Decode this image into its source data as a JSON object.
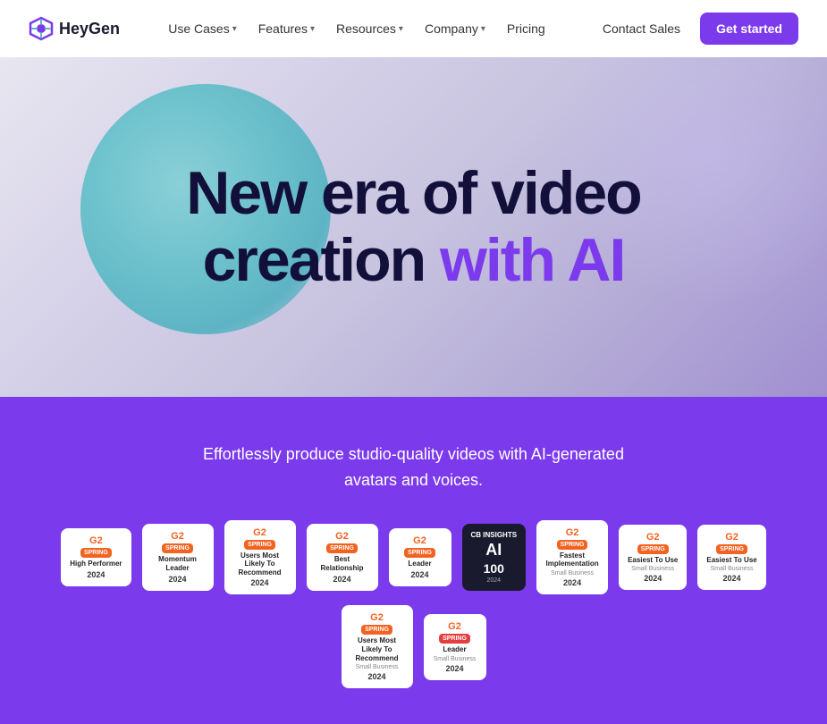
{
  "logo": {
    "text": "HeyGen"
  },
  "nav": {
    "items": [
      {
        "label": "Use Cases",
        "hasDropdown": true
      },
      {
        "label": "Features",
        "hasDropdown": true
      },
      {
        "label": "Resources",
        "hasDropdown": true
      },
      {
        "label": "Company",
        "hasDropdown": true
      },
      {
        "label": "Pricing",
        "hasDropdown": false
      }
    ],
    "contact_sales": "Contact Sales",
    "get_started": "Get started"
  },
  "hero": {
    "line1": "New era of video",
    "line2_plain": "creation ",
    "line2_colored": "with AI"
  },
  "social_proof": {
    "description": "Effortlessly produce studio-quality videos with AI-generated avatars and voices.",
    "badges": [
      {
        "type": "g2",
        "icon": "G2",
        "title": "High Performer",
        "category": "",
        "tag": "SPRING",
        "year": "2024"
      },
      {
        "type": "g2",
        "icon": "G2",
        "title": "Momentum Leader",
        "category": "",
        "tag": "SPRING",
        "year": "2024"
      },
      {
        "type": "g2",
        "icon": "G2",
        "title": "Users Most Likely To Recommend",
        "category": "",
        "tag": "SPRING",
        "year": "2024"
      },
      {
        "type": "g2",
        "icon": "G2",
        "title": "Best Relationship",
        "category": "",
        "tag": "SPRING",
        "year": "2024"
      },
      {
        "type": "g2",
        "icon": "G2",
        "title": "Leader",
        "category": "",
        "tag": "SPRING",
        "year": "2024",
        "highlight": "orange"
      },
      {
        "type": "cb",
        "title": "AI 100",
        "subtitle": "2024"
      },
      {
        "type": "g2",
        "icon": "G2",
        "title": "Fastest Implementation",
        "category": "Small Business",
        "tag": "SPRING",
        "year": "2024"
      },
      {
        "type": "g2",
        "icon": "G2",
        "title": "Easiest To Use",
        "category": "Small Business",
        "tag": "SPRING",
        "year": "2024"
      },
      {
        "type": "g2",
        "icon": "G2",
        "title": "Easiest To Use",
        "category": "Small Business",
        "tag": "SPRING",
        "year": "2024"
      },
      {
        "type": "g2",
        "icon": "G2",
        "title": "Users Most Likely To Recommend",
        "category": "Small Business",
        "tag": "SPRING",
        "year": "2024"
      },
      {
        "type": "g2",
        "icon": "G2",
        "title": "Leader",
        "category": "Small Business",
        "tag": "SPRING",
        "year": "2024",
        "highlight": "red"
      }
    ]
  }
}
